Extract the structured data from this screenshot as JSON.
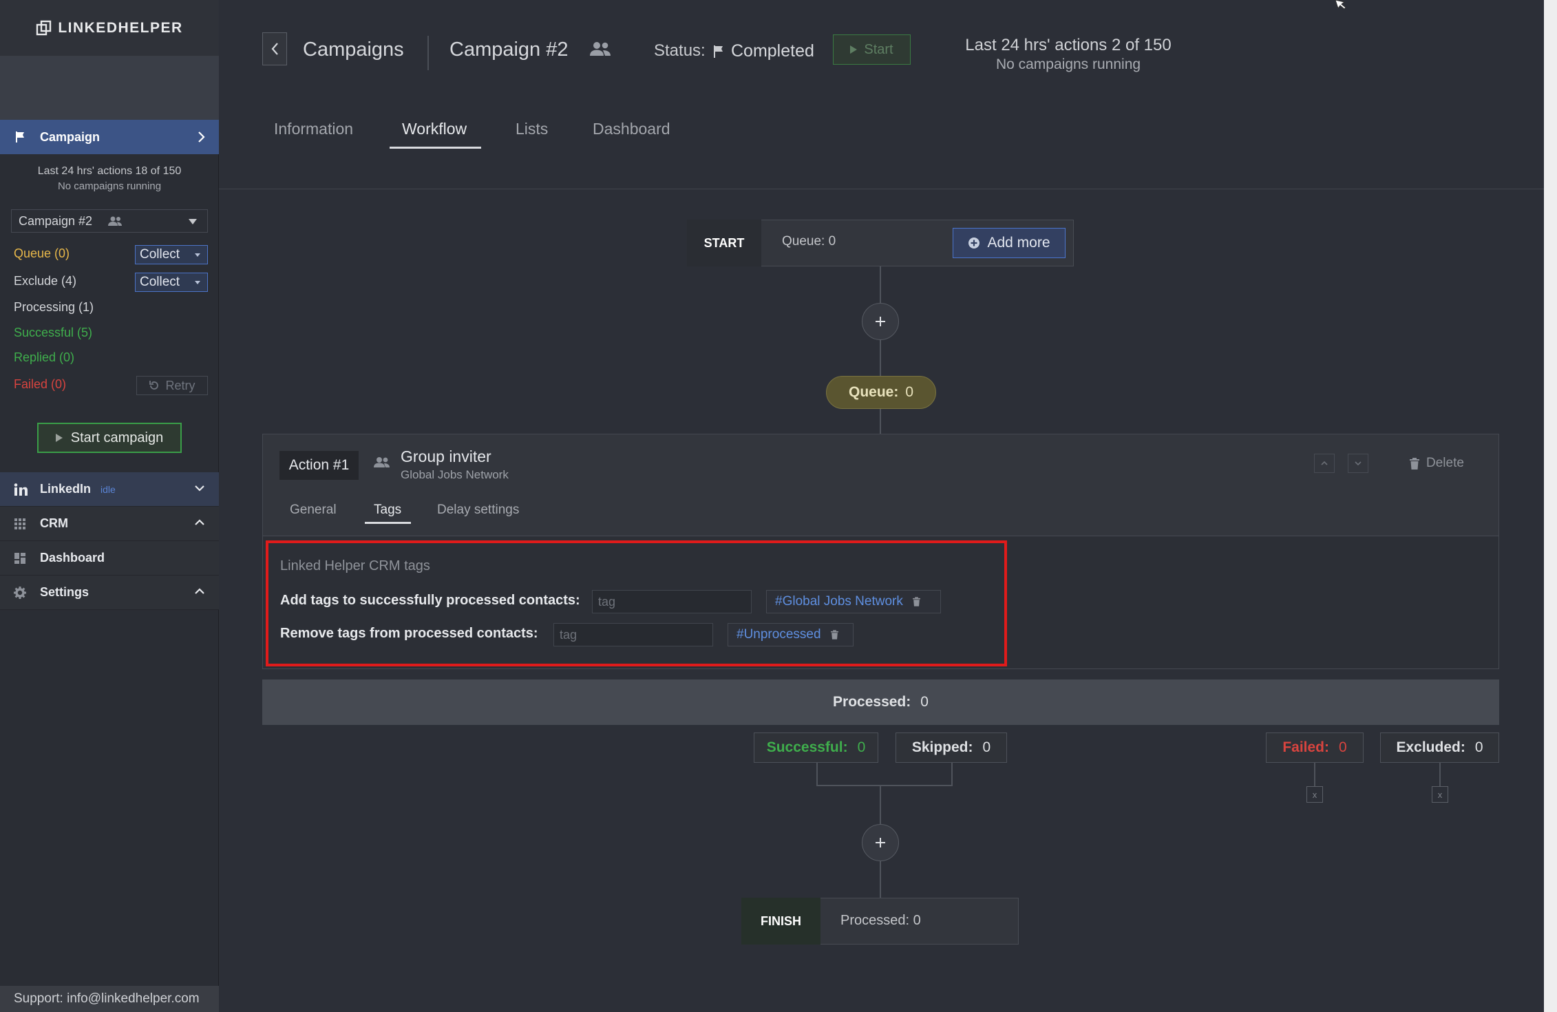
{
  "app": {
    "logo_text": "LINKEDHELPER"
  },
  "sidebar": {
    "campaign_label": "Campaign",
    "actions_line1": "Last 24 hrs' actions 18 of 150",
    "actions_line2": "No campaigns running",
    "campaign_select": "Campaign #2",
    "queue": "Queue (0)",
    "exclude": "Exclude (4)",
    "processing": "Processing (1)",
    "successful": "Successful (5)",
    "replied": "Replied (0)",
    "failed": "Failed (0)",
    "collect_label": "Collect",
    "retry_label": "Retry",
    "start_campaign": "Start campaign",
    "linkedin_label": "LinkedIn",
    "linkedin_status": "idle",
    "crm_label": "CRM",
    "dashboard_label": "Dashboard",
    "settings_label": "Settings",
    "support": "Support: info@linkedhelper.com"
  },
  "header": {
    "breadcrumb_root": "Campaigns",
    "campaign_name": "Campaign #2",
    "status_label": "Status:",
    "status_value": "Completed",
    "start_label": "Start",
    "actions_line1": "Last 24 hrs' actions 2 of 150",
    "actions_line2": "No campaigns running"
  },
  "tabs": {
    "information": "Information",
    "workflow": "Workflow",
    "lists": "Lists",
    "dashboard": "Dashboard"
  },
  "workflow": {
    "start_tag": "START",
    "start_queue": "Queue: 0",
    "add_more": "Add more",
    "queue_label": "Queue:",
    "queue_value": "0",
    "action": {
      "number": "Action #1",
      "title": "Group inviter",
      "subtitle": "Global Jobs Network",
      "delete_label": "Delete",
      "subtabs": {
        "general": "General",
        "tags": "Tags",
        "delay": "Delay settings"
      },
      "crm_title": "Linked Helper CRM tags",
      "add_tags_label": "Add tags to successfully processed contacts:",
      "remove_tags_label": "Remove tags from processed contacts:",
      "tag_placeholder": "tag",
      "add_tag_chip": "#Global Jobs Network",
      "remove_tag_chip": "#Unprocessed"
    },
    "processed_label": "Processed:",
    "processed_value": "0",
    "results": {
      "successful_label": "Successful:",
      "successful_value": "0",
      "skipped_label": "Skipped:",
      "skipped_value": "0",
      "failed_label": "Failed:",
      "failed_value": "0",
      "excluded_label": "Excluded:",
      "excluded_value": "0"
    },
    "x_label": "x",
    "finish_tag": "FINISH",
    "finish_processed": "Processed: 0"
  },
  "colors": {
    "accent_blue": "#4b74cc",
    "success_green": "#3fae4c",
    "failed_red": "#d9443f",
    "queue_yellow": "#e8b84a",
    "highlight_red": "#e01b1b"
  },
  "icons": [
    "logo-icon",
    "flag-icon",
    "chevron-right-icon",
    "users-icon",
    "caret-down-icon",
    "retry-icon",
    "play-icon",
    "linkedin-icon",
    "chevron-down-icon",
    "grid-icon",
    "chevron-up-icon",
    "dashboard-icon",
    "gear-icon",
    "back-arrow-icon",
    "plus-circle-icon",
    "plus-icon",
    "trash-icon",
    "x-icon"
  ]
}
